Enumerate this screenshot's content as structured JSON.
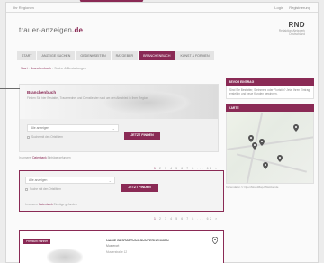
{
  "topline": {
    "left": "Ihr Regionen",
    "right_links": [
      "Login",
      "Registrierung",
      ""
    ]
  },
  "brand": {
    "logo_prefix": "trauer-anzeigen",
    "logo_tld": ".de",
    "partner_mark": "RND",
    "partner_sub": "RedaktionsNetzwerk Deutschland"
  },
  "nav": {
    "tabs": [
      "Start",
      "Anzeige suchen",
      "Gedenkseiten",
      "Ratgeber",
      "Branchenbuch",
      "Kunst & Formen"
    ],
    "active_index": 4
  },
  "breadcrumb": {
    "home": "Start",
    "section": "Branchenbuch",
    "current": "Suche & Bestattungen"
  },
  "search": {
    "title": "Branchenbuch",
    "description": "Finden Sie hier Bestatter, Trauerredner und Dienstleister rund um den Abschied in Ihrer Region.",
    "select_placeholder": "Alle anzeigen",
    "checkbox_label": "Suche mit den Ortsfiltern",
    "button_label": "JETZT FINDEN",
    "results_prefix": "In unserer",
    "results_link": "Datenbank",
    "results_suffix": "Einträge gefunden"
  },
  "search2": {
    "select_placeholder": "Alle anzeigen",
    "checkbox_label": "Suche mit den Ortsfiltern",
    "button_label": "JETZT FINDEN",
    "results_prefix": "In unserer",
    "results_link": "Datenbank",
    "results_suffix": "Einträge gefunden"
  },
  "pager": {
    "pages": [
      "1",
      "2",
      "3",
      "4",
      "5",
      "6",
      "7",
      "8",
      "...",
      "62",
      ">"
    ],
    "active": "1"
  },
  "listing": {
    "badge": "Premium Partner",
    "name": "NAME BESTATTUNGSUNTERNEHMEN",
    "city": "Musterort",
    "phone": "Musterstraße 12"
  },
  "sidebar": {
    "info_title": "BEVOR EINTRAG",
    "info_text": "Sind Sie Bestatter, Steinmetz oder Floristin? Jetzt Ihren Eintrag erstellen und neue Kunden gewinnen.",
    "map_title": "KARTE",
    "map_footer": "Kartendaten © OpenStreetMap-Mitwirkende"
  },
  "colors": {
    "accent": "#8a2a55",
    "background": "#ececec"
  }
}
